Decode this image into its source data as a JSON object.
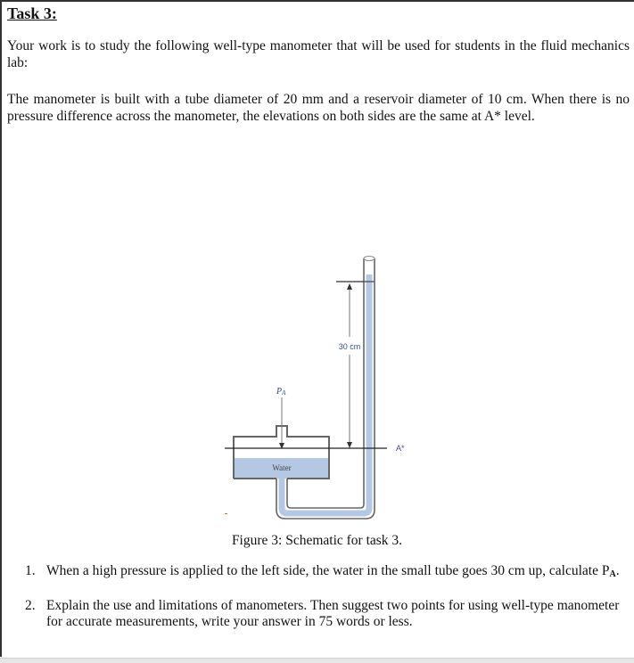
{
  "task": {
    "title": "Task 3:",
    "intro": "Your work is to study the following well-type manometer that will be used for students in the fluid mechanics lab:",
    "description": "The manometer is built with a tube diameter of 20 mm and a reservoir diameter of 10 cm. When there is no pressure difference across the manometer, the elevations on both sides are the same at A* level."
  },
  "figure": {
    "height_label": "30 cm",
    "pressure_label": "P",
    "pressure_sub": "A",
    "fluid_label": "Water",
    "reference_label": "A*",
    "caption": "Figure 3: Schematic for task 3.",
    "colors": {
      "water": "#b4c8e4",
      "outline": "#666666",
      "label_blue": "#3a4f8a",
      "label_orange": "#c0762a"
    }
  },
  "questions": [
    {
      "number": "1.",
      "text": "When a high pressure is applied to the left side, the water in the small tube goes 30 cm up, calculate P",
      "sub": "A",
      "suffix": "."
    },
    {
      "number": "2.",
      "text": "Explain the use and limitations of manometers. Then suggest two points for using well-type manometer for accurate measurements, write your answer in 75 words or less."
    }
  ]
}
